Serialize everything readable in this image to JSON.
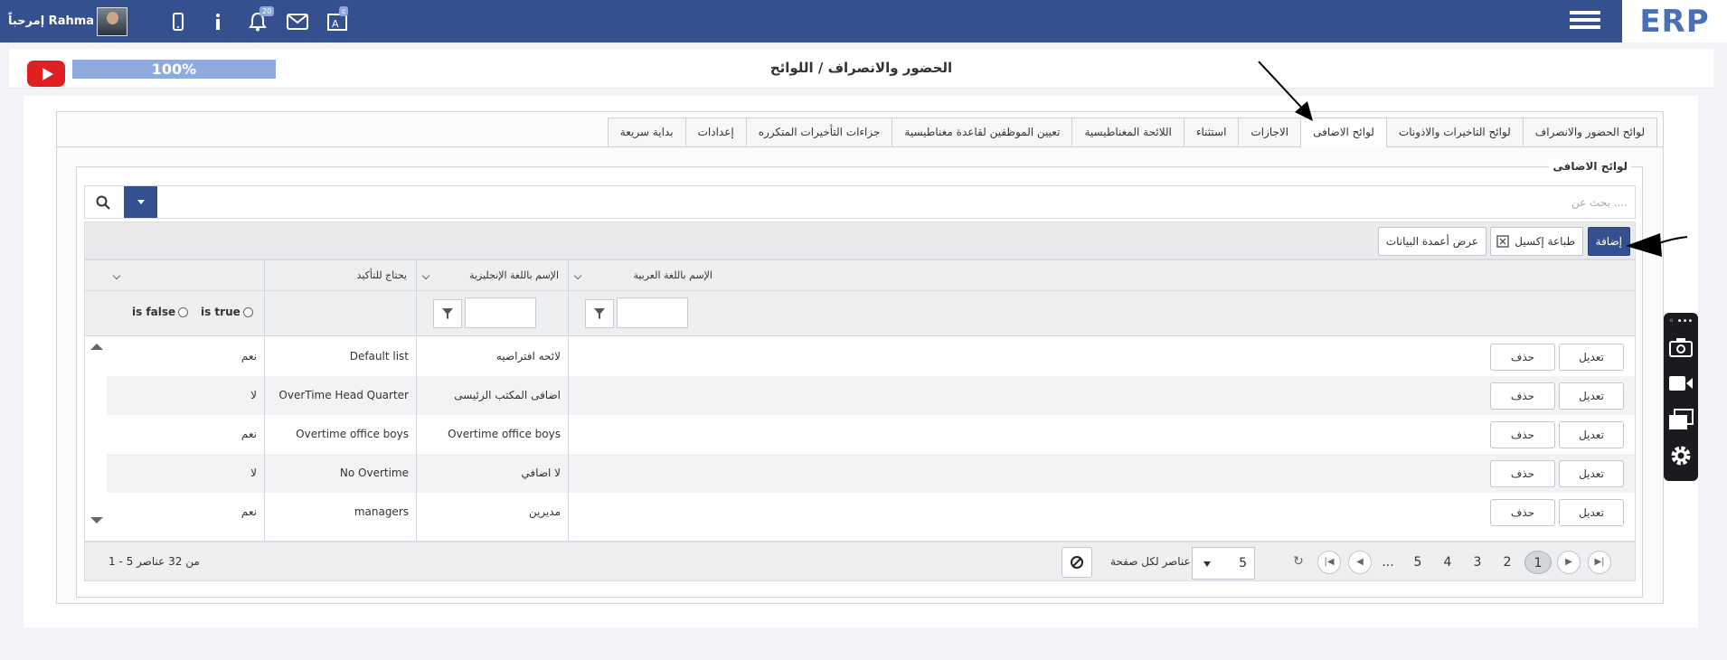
{
  "topbar": {
    "logo": "ERP",
    "welcome": "إمرحباً Rahma",
    "notifications_count": "20",
    "translate_badge": "c"
  },
  "titlebar": {
    "progress": "100%",
    "title": "الحضور والانصراف / اللوائح"
  },
  "tabs": [
    {
      "label": "لوائح الحضور والانصراف",
      "active": false
    },
    {
      "label": "لوائح التاخيرات والاذونات",
      "active": false
    },
    {
      "label": "لوائح الاضافى",
      "active": true
    },
    {
      "label": "الاجازات",
      "active": false
    },
    {
      "label": "استثناء",
      "active": false
    },
    {
      "label": "اللائحة المغناطيسية",
      "active": false
    },
    {
      "label": "تعيين الموظفين لقاعدة مغناطيسية",
      "active": false
    },
    {
      "label": "جزاءات التأخيرات المتكرره",
      "active": false
    },
    {
      "label": "إعدادات",
      "active": false
    },
    {
      "label": "بداية سريعة",
      "active": false
    }
  ],
  "section": {
    "legend": "لوائح الاضافى",
    "search_placeholder": "بحث عن ...."
  },
  "toolbar": {
    "add": "إضافة",
    "excel": "طباعة إكسيل",
    "columns": "عرض أعمدة البيانات"
  },
  "grid": {
    "columns": [
      "الإسم باللغة العربية",
      "الإسم باللغة الإنجليزية",
      "يحتاج للتأكيد"
    ],
    "filter": {
      "is_true": "is true",
      "is_false": "is false"
    },
    "edit_label": "تعديل",
    "delete_label": "حذف",
    "rows": [
      {
        "ar": "لائحه افتراضيه",
        "en": "Default list",
        "confirm": "نعم"
      },
      {
        "ar": "اضافى المكتب الرئيسى",
        "en": "OverTime Head Quarter",
        "confirm": "لا"
      },
      {
        "ar": "Overtime office boys",
        "en": "Overtime office boys",
        "confirm": "نعم"
      },
      {
        "ar": "لا اضافي",
        "en": "No Overtime",
        "confirm": "لا"
      },
      {
        "ar": "مديرين",
        "en": "managers",
        "confirm": "نعم"
      }
    ]
  },
  "pager": {
    "pages": [
      "1",
      "2",
      "3",
      "4",
      "5",
      "..."
    ],
    "current_page": "1",
    "page_size": "5",
    "page_size_label": "عناصر لكل صفحة",
    "summary": "1 - 5 من 32 عناصر"
  },
  "colors": {
    "primary": "#34508f",
    "progress": "#8faade",
    "youtube": "#e02020"
  }
}
